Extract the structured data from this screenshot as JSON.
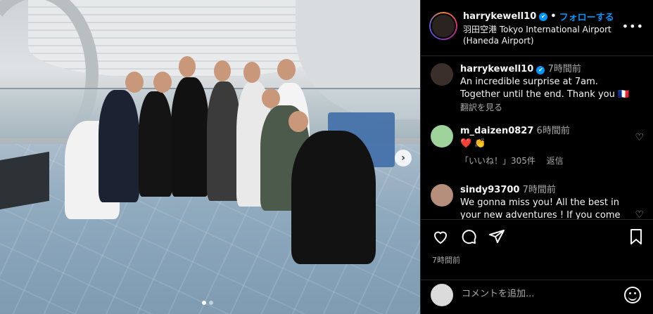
{
  "post": {
    "username": "harrykewell10",
    "follow_separator": "•",
    "follow_label": "フォローする",
    "location": "羽田空港 Tokyo International Airport (Haneda Airport)",
    "more_glyph": "•••",
    "posted_time": "7時間前"
  },
  "carousel": {
    "next_glyph": "›",
    "total": 2,
    "active_index": 0
  },
  "comments": [
    {
      "username": "harrykewell10",
      "time": "7時間前",
      "text": "An incredible surprise at 7am. Together until the end. Thank you 🇫🇷",
      "meta": [
        "翻訳を見る"
      ]
    },
    {
      "username": "m_daizen0827",
      "time": "6時間前",
      "text": "❤️ 👏",
      "meta": [
        "「いいね！」305件",
        "返信"
      ]
    },
    {
      "username": "sindy93700",
      "time": "7時間前",
      "text": "We gonna miss you! All the best in your new adventures ! If you come",
      "meta": []
    }
  ],
  "add_comment": {
    "placeholder": "コメントを追加..."
  },
  "colors": {
    "accent": "#0095f6",
    "background": "#000000",
    "muted_text": "#a8a8a8"
  },
  "icons": {
    "like": "heart-icon",
    "comment": "comment-icon",
    "share": "share-icon",
    "save": "bookmark-icon",
    "emoji": "emoji-icon"
  }
}
